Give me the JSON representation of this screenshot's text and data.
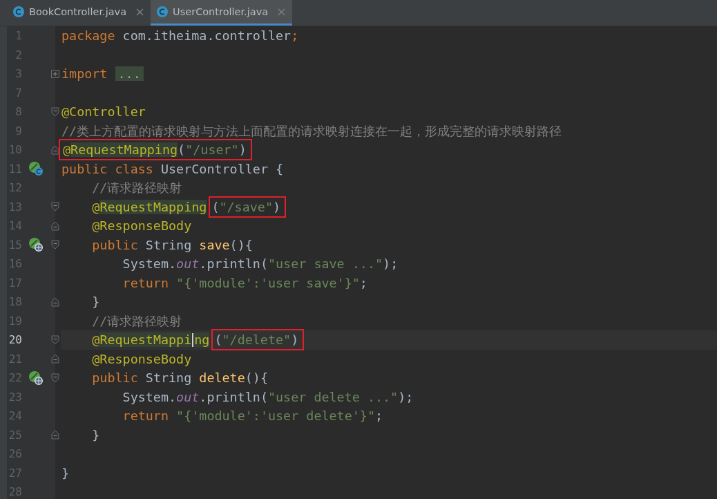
{
  "tabs": [
    {
      "label": "BookController.java",
      "selected": false
    },
    {
      "label": "UserController.java",
      "selected": true
    }
  ],
  "lines": [
    {
      "number": "1",
      "current": false,
      "tokens": [
        {
          "kind": "keyword",
          "text": "package"
        },
        {
          "kind": "plain",
          "text": " com.itheima.controller"
        },
        {
          "kind": "keyword",
          "text": ";"
        }
      ]
    },
    {
      "number": "2",
      "current": false
    },
    {
      "number": "3",
      "current": false,
      "fold_marker": {
        "kind": "collapsed"
      },
      "tokens": [
        {
          "kind": "keyword",
          "text": "import "
        },
        {
          "kind": "folded",
          "text": "..."
        }
      ]
    },
    {
      "number": "7",
      "current": false
    },
    {
      "number": "8",
      "current": false,
      "fold_marker": {
        "kind": "start"
      },
      "tokens": [
        {
          "kind": "annotation",
          "text": "@Controller"
        }
      ]
    },
    {
      "number": "9",
      "current": false,
      "tokens": [
        {
          "kind": "comment",
          "text": "//类上方配置的请求映射与方法上面配置的请求映射连接在一起，形成完整的请求映射路径"
        }
      ]
    },
    {
      "number": "10",
      "current": false,
      "fold_marker": {
        "kind": "end"
      },
      "tokens": [
        {
          "kind": "box",
          "tokens": [
            {
              "kind": "annotation",
              "text": "@"
            },
            {
              "kind": "annotation",
              "text": "RequestMapping",
              "highlighted": true
            },
            {
              "kind": "plain",
              "text": "("
            },
            {
              "kind": "string",
              "text": "\"/user\""
            },
            {
              "kind": "plain",
              "text": ")"
            }
          ]
        }
      ]
    },
    {
      "number": "11",
      "current": false,
      "gutter_icon": {
        "kind": "class"
      },
      "tokens": [
        {
          "kind": "keyword",
          "text": "public class"
        },
        {
          "kind": "plain",
          "text": " UserController {"
        }
      ]
    },
    {
      "number": "12",
      "current": false,
      "tokens": [
        {
          "kind": "comment",
          "text": "    //请求路径映射"
        }
      ]
    },
    {
      "number": "13",
      "current": false,
      "fold_marker": {
        "kind": "start"
      },
      "tokens": [
        {
          "kind": "annotation",
          "text": "    @"
        },
        {
          "kind": "annotation",
          "text": "RequestMapping",
          "highlighted": true
        },
        {
          "kind": "box",
          "tokens": [
            {
              "kind": "plain",
              "text": "("
            },
            {
              "kind": "string",
              "text": "\"/save\""
            },
            {
              "kind": "plain",
              "text": ")"
            }
          ]
        }
      ]
    },
    {
      "number": "14",
      "current": false,
      "fold_marker": {
        "kind": "end"
      },
      "tokens": [
        {
          "kind": "annotation",
          "text": "    @ResponseBody"
        }
      ]
    },
    {
      "number": "15",
      "current": false,
      "gutter_icon": {
        "kind": "web"
      },
      "fold_marker": {
        "kind": "start"
      },
      "tokens": [
        {
          "kind": "keyword",
          "text": "    public"
        },
        {
          "kind": "plain",
          "text": " String "
        },
        {
          "kind": "method",
          "text": "save"
        },
        {
          "kind": "plain",
          "text": "(){"
        }
      ]
    },
    {
      "number": "16",
      "current": false,
      "tokens": [
        {
          "kind": "plain",
          "text": "        System."
        },
        {
          "kind": "field",
          "text": "out"
        },
        {
          "kind": "plain",
          "text": ".println("
        },
        {
          "kind": "string",
          "text": "\"user save ...\""
        },
        {
          "kind": "plain",
          "text": ");"
        }
      ]
    },
    {
      "number": "17",
      "current": false,
      "tokens": [
        {
          "kind": "keyword",
          "text": "        return "
        },
        {
          "kind": "string",
          "text": "\"{'module':'user save'}\""
        },
        {
          "kind": "plain",
          "text": ";"
        }
      ]
    },
    {
      "number": "18",
      "current": false,
      "fold_marker": {
        "kind": "end"
      },
      "tokens": [
        {
          "kind": "plain",
          "text": "    }"
        }
      ]
    },
    {
      "number": "19",
      "current": false,
      "tokens": [
        {
          "kind": "comment",
          "text": "    //请求路径映射"
        }
      ]
    },
    {
      "number": "20",
      "current": true,
      "fold_marker": {
        "kind": "start"
      },
      "tokens": [
        {
          "kind": "annotation",
          "text": "    @"
        },
        {
          "kind": "annotation",
          "text": "RequestMappi",
          "highlighted": true
        },
        {
          "kind": "caret"
        },
        {
          "kind": "annotation",
          "text": "ng",
          "highlighted": true
        },
        {
          "kind": "box",
          "tokens": [
            {
              "kind": "plain",
              "text": "("
            },
            {
              "kind": "string",
              "text": "\"/delete\""
            },
            {
              "kind": "plain",
              "text": ")"
            }
          ]
        }
      ]
    },
    {
      "number": "21",
      "current": false,
      "fold_marker": {
        "kind": "end"
      },
      "tokens": [
        {
          "kind": "annotation",
          "text": "    @ResponseBody"
        }
      ]
    },
    {
      "number": "22",
      "current": false,
      "gutter_icon": {
        "kind": "web"
      },
      "fold_marker": {
        "kind": "start"
      },
      "tokens": [
        {
          "kind": "keyword",
          "text": "    public"
        },
        {
          "kind": "plain",
          "text": " String "
        },
        {
          "kind": "method",
          "text": "delete"
        },
        {
          "kind": "plain",
          "text": "(){"
        }
      ]
    },
    {
      "number": "23",
      "current": false,
      "tokens": [
        {
          "kind": "plain",
          "text": "        System."
        },
        {
          "kind": "field",
          "text": "out"
        },
        {
          "kind": "plain",
          "text": ".println("
        },
        {
          "kind": "string",
          "text": "\"user delete ...\""
        },
        {
          "kind": "plain",
          "text": ");"
        }
      ]
    },
    {
      "number": "24",
      "current": false,
      "tokens": [
        {
          "kind": "keyword",
          "text": "        return "
        },
        {
          "kind": "string",
          "text": "\"{'module':'user delete'}\""
        },
        {
          "kind": "plain",
          "text": ";"
        }
      ]
    },
    {
      "number": "25",
      "current": false,
      "fold_marker": {
        "kind": "end"
      },
      "tokens": [
        {
          "kind": "plain",
          "text": "    }"
        }
      ]
    },
    {
      "number": "26",
      "current": false
    },
    {
      "number": "27",
      "current": false,
      "tokens": [
        {
          "kind": "plain",
          "text": "}"
        }
      ]
    },
    {
      "number": "28",
      "current": false
    }
  ]
}
